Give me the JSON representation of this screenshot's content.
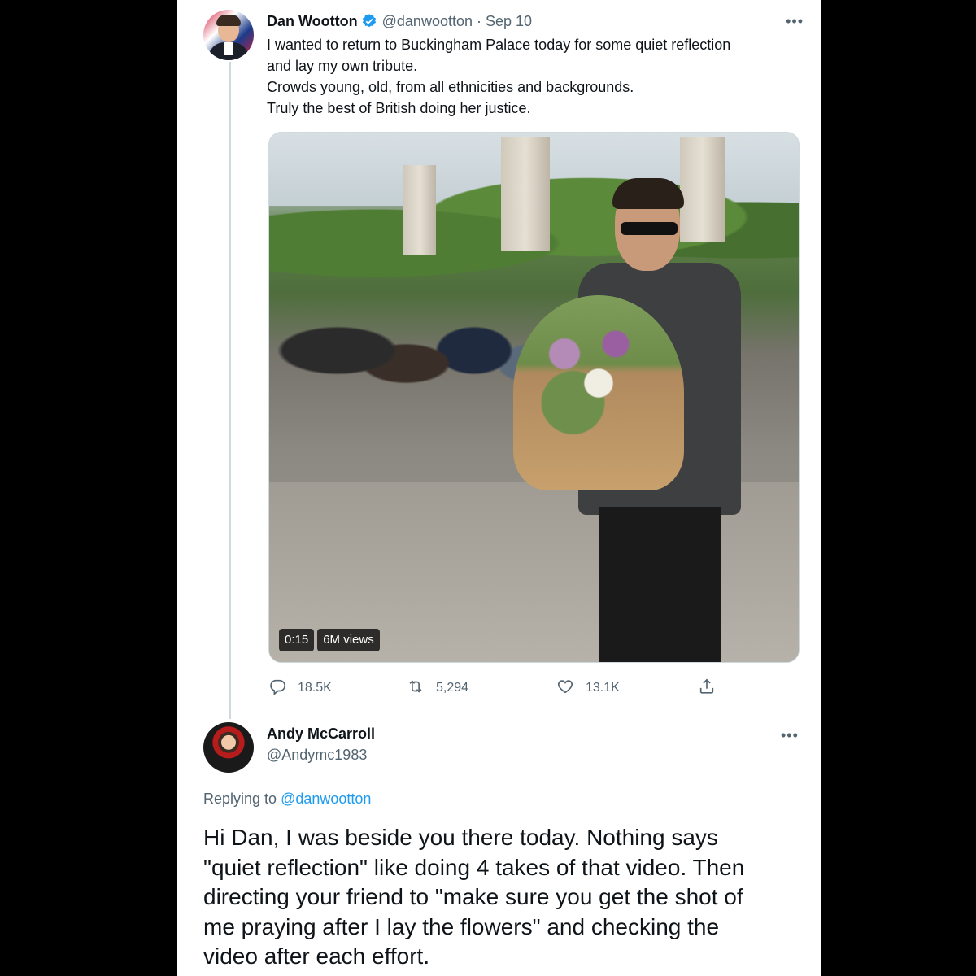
{
  "tweet": {
    "display_name": "Dan Wootton",
    "handle_date": "@danwootton · Sep 10",
    "text_lines": [
      "I wanted to return to Buckingham Palace today for some quiet reflection",
      "and lay my own tribute.",
      "Crowds young, old, from all ethnicities and backgrounds.",
      "Truly the best of British doing her justice."
    ],
    "video": {
      "duration": "0:15",
      "views": "6M views"
    },
    "actions": {
      "replies": "18.5K",
      "retweets": "5,294",
      "likes": "13.1K"
    },
    "icons": [
      "verified-icon",
      "more-icon",
      "reply-icon",
      "retweet-icon",
      "like-icon",
      "share-icon"
    ],
    "colors": {
      "verified": "#1d9bf0",
      "secondary_text": "#536471",
      "link": "#1d9bf0"
    }
  },
  "reply": {
    "display_name": "Andy McCarroll",
    "handle": "@Andymc1983",
    "replying_prefix": "Replying to",
    "replying_to": "@danwootton",
    "text_lines": [
      "Hi Dan, I was beside you there today. Nothing says",
      "\"quiet reflection\" like doing 4 takes of that video. Then",
      "directing your friend to \"make sure you get the shot of",
      "me praying after I lay the flowers\" and checking the",
      "video after each effort."
    ]
  }
}
